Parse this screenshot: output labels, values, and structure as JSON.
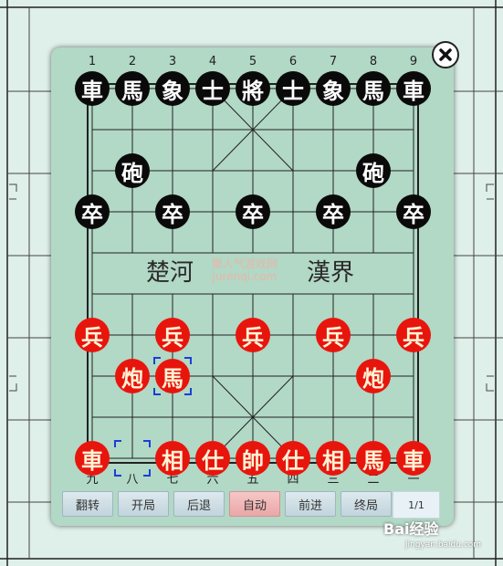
{
  "board": {
    "file_labels_top": [
      "1",
      "2",
      "3",
      "4",
      "5",
      "6",
      "7",
      "8",
      "9"
    ],
    "file_labels_bottom": [
      "九",
      "八",
      "七",
      "六",
      "五",
      "四",
      "三",
      "二",
      "一"
    ],
    "river_left": "楚河",
    "river_right": "漢界",
    "watermark_line1": "聚人气游戏网",
    "watermark_line2": "jurenqi.com",
    "pieces": [
      {
        "side": "black",
        "char": "車",
        "file": 0,
        "rank": 0
      },
      {
        "side": "black",
        "char": "馬",
        "file": 1,
        "rank": 0
      },
      {
        "side": "black",
        "char": "象",
        "file": 2,
        "rank": 0
      },
      {
        "side": "black",
        "char": "士",
        "file": 3,
        "rank": 0
      },
      {
        "side": "black",
        "char": "將",
        "file": 4,
        "rank": 0
      },
      {
        "side": "black",
        "char": "士",
        "file": 5,
        "rank": 0
      },
      {
        "side": "black",
        "char": "象",
        "file": 6,
        "rank": 0
      },
      {
        "side": "black",
        "char": "馬",
        "file": 7,
        "rank": 0
      },
      {
        "side": "black",
        "char": "車",
        "file": 8,
        "rank": 0
      },
      {
        "side": "black",
        "char": "砲",
        "file": 1,
        "rank": 2
      },
      {
        "side": "black",
        "char": "砲",
        "file": 7,
        "rank": 2
      },
      {
        "side": "black",
        "char": "卒",
        "file": 0,
        "rank": 3
      },
      {
        "side": "black",
        "char": "卒",
        "file": 2,
        "rank": 3
      },
      {
        "side": "black",
        "char": "卒",
        "file": 4,
        "rank": 3
      },
      {
        "side": "black",
        "char": "卒",
        "file": 6,
        "rank": 3
      },
      {
        "side": "black",
        "char": "卒",
        "file": 8,
        "rank": 3
      },
      {
        "side": "red",
        "char": "兵",
        "file": 0,
        "rank": 6
      },
      {
        "side": "red",
        "char": "兵",
        "file": 2,
        "rank": 6
      },
      {
        "side": "red",
        "char": "兵",
        "file": 4,
        "rank": 6
      },
      {
        "side": "red",
        "char": "兵",
        "file": 6,
        "rank": 6
      },
      {
        "side": "red",
        "char": "兵",
        "file": 8,
        "rank": 6
      },
      {
        "side": "red",
        "char": "炮",
        "file": 1,
        "rank": 7
      },
      {
        "side": "red",
        "char": "馬",
        "file": 2,
        "rank": 7
      },
      {
        "side": "red",
        "char": "炮",
        "file": 7,
        "rank": 7
      },
      {
        "side": "red",
        "char": "車",
        "file": 0,
        "rank": 9
      },
      {
        "side": "red",
        "char": "相",
        "file": 2,
        "rank": 9
      },
      {
        "side": "red",
        "char": "仕",
        "file": 3,
        "rank": 9
      },
      {
        "side": "red",
        "char": "帥",
        "file": 4,
        "rank": 9
      },
      {
        "side": "red",
        "char": "仕",
        "file": 5,
        "rank": 9
      },
      {
        "side": "red",
        "char": "相",
        "file": 6,
        "rank": 9
      },
      {
        "side": "red",
        "char": "馬",
        "file": 7,
        "rank": 9
      },
      {
        "side": "red",
        "char": "車",
        "file": 8,
        "rank": 9
      }
    ],
    "last_move_from": {
      "file": 1,
      "rank": 9
    },
    "last_move_to": {
      "file": 2,
      "rank": 7
    }
  },
  "controls": {
    "flip": "翻转",
    "start": "开局",
    "back": "后退",
    "auto": "自动",
    "forward": "前进",
    "end": "终局",
    "page": "1/1"
  },
  "colors": {
    "panel": "#b2d8c6",
    "red_piece": "#e8150d",
    "black_piece": "#0a0a0a",
    "highlight": "#1a3fd6"
  },
  "icons": {
    "close": "close-icon"
  },
  "brand": {
    "name": "Bai经验",
    "sub": "jingyan.baidu.com"
  }
}
